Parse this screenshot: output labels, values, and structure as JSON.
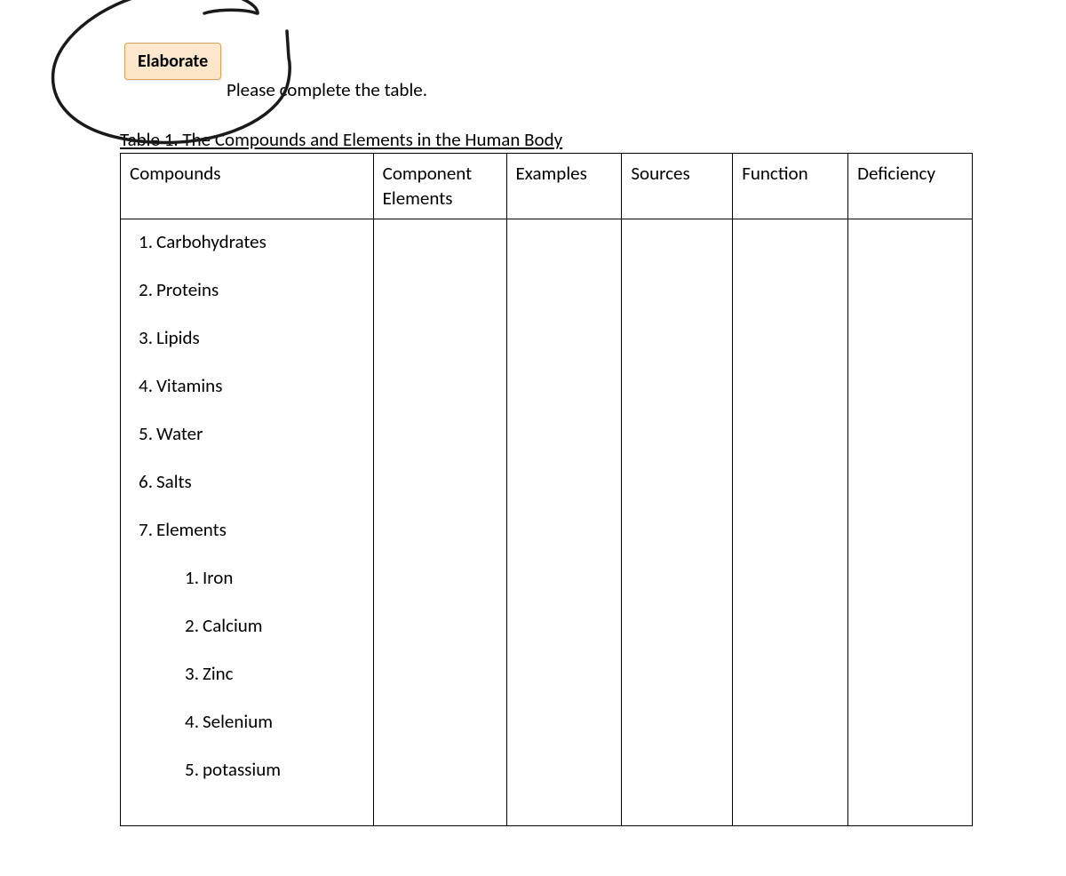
{
  "badge": {
    "label": "Elaborate"
  },
  "instruction": "Please complete the table.",
  "caption": "Table 1. The Compounds and Elements in the Human Body",
  "headers": {
    "compounds": "Compounds",
    "component_elements": "Component Elements",
    "examples": "Examples",
    "sources": "Sources",
    "function": "Function",
    "deficiency": "Deficiency"
  },
  "rows": {
    "main": [
      {
        "num": "1",
        "label": "Carbohydrates"
      },
      {
        "num": "2",
        "label": "Proteins"
      },
      {
        "num": "3",
        "label": "Lipids"
      },
      {
        "num": "4",
        "label": "Vitamins"
      },
      {
        "num": "5",
        "label": "Water"
      },
      {
        "num": "6",
        "label": "Salts"
      },
      {
        "num": "7",
        "label": "Elements"
      }
    ],
    "sub": [
      {
        "num": "1",
        "label": "Iron"
      },
      {
        "num": "2",
        "label": "Calcium"
      },
      {
        "num": "3",
        "label": "Zinc"
      },
      {
        "num": "4",
        "label": "Selenium"
      },
      {
        "num": "5",
        "label": "potassium"
      }
    ]
  }
}
